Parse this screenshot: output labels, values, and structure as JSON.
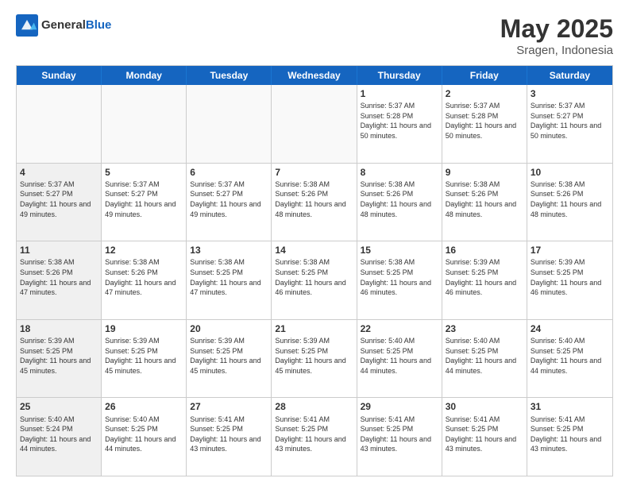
{
  "header": {
    "logo_general": "General",
    "logo_blue": "Blue",
    "month_year": "May 2025",
    "location": "Sragen, Indonesia"
  },
  "day_headers": [
    "Sunday",
    "Monday",
    "Tuesday",
    "Wednesday",
    "Thursday",
    "Friday",
    "Saturday"
  ],
  "weeks": [
    [
      {
        "num": "",
        "info": "",
        "shaded": true
      },
      {
        "num": "",
        "info": "",
        "shaded": true
      },
      {
        "num": "",
        "info": "",
        "shaded": true
      },
      {
        "num": "",
        "info": "",
        "shaded": true
      },
      {
        "num": "1",
        "info": "Sunrise: 5:37 AM\nSunset: 5:28 PM\nDaylight: 11 hours\nand 50 minutes.",
        "shaded": false
      },
      {
        "num": "2",
        "info": "Sunrise: 5:37 AM\nSunset: 5:28 PM\nDaylight: 11 hours\nand 50 minutes.",
        "shaded": false
      },
      {
        "num": "3",
        "info": "Sunrise: 5:37 AM\nSunset: 5:27 PM\nDaylight: 11 hours\nand 50 minutes.",
        "shaded": false
      }
    ],
    [
      {
        "num": "4",
        "info": "Sunrise: 5:37 AM\nSunset: 5:27 PM\nDaylight: 11 hours\nand 49 minutes.",
        "shaded": true
      },
      {
        "num": "5",
        "info": "Sunrise: 5:37 AM\nSunset: 5:27 PM\nDaylight: 11 hours\nand 49 minutes.",
        "shaded": false
      },
      {
        "num": "6",
        "info": "Sunrise: 5:37 AM\nSunset: 5:27 PM\nDaylight: 11 hours\nand 49 minutes.",
        "shaded": false
      },
      {
        "num": "7",
        "info": "Sunrise: 5:38 AM\nSunset: 5:26 PM\nDaylight: 11 hours\nand 48 minutes.",
        "shaded": false
      },
      {
        "num": "8",
        "info": "Sunrise: 5:38 AM\nSunset: 5:26 PM\nDaylight: 11 hours\nand 48 minutes.",
        "shaded": false
      },
      {
        "num": "9",
        "info": "Sunrise: 5:38 AM\nSunset: 5:26 PM\nDaylight: 11 hours\nand 48 minutes.",
        "shaded": false
      },
      {
        "num": "10",
        "info": "Sunrise: 5:38 AM\nSunset: 5:26 PM\nDaylight: 11 hours\nand 48 minutes.",
        "shaded": false
      }
    ],
    [
      {
        "num": "11",
        "info": "Sunrise: 5:38 AM\nSunset: 5:26 PM\nDaylight: 11 hours\nand 47 minutes.",
        "shaded": true
      },
      {
        "num": "12",
        "info": "Sunrise: 5:38 AM\nSunset: 5:26 PM\nDaylight: 11 hours\nand 47 minutes.",
        "shaded": false
      },
      {
        "num": "13",
        "info": "Sunrise: 5:38 AM\nSunset: 5:25 PM\nDaylight: 11 hours\nand 47 minutes.",
        "shaded": false
      },
      {
        "num": "14",
        "info": "Sunrise: 5:38 AM\nSunset: 5:25 PM\nDaylight: 11 hours\nand 46 minutes.",
        "shaded": false
      },
      {
        "num": "15",
        "info": "Sunrise: 5:38 AM\nSunset: 5:25 PM\nDaylight: 11 hours\nand 46 minutes.",
        "shaded": false
      },
      {
        "num": "16",
        "info": "Sunrise: 5:39 AM\nSunset: 5:25 PM\nDaylight: 11 hours\nand 46 minutes.",
        "shaded": false
      },
      {
        "num": "17",
        "info": "Sunrise: 5:39 AM\nSunset: 5:25 PM\nDaylight: 11 hours\nand 46 minutes.",
        "shaded": false
      }
    ],
    [
      {
        "num": "18",
        "info": "Sunrise: 5:39 AM\nSunset: 5:25 PM\nDaylight: 11 hours\nand 45 minutes.",
        "shaded": true
      },
      {
        "num": "19",
        "info": "Sunrise: 5:39 AM\nSunset: 5:25 PM\nDaylight: 11 hours\nand 45 minutes.",
        "shaded": false
      },
      {
        "num": "20",
        "info": "Sunrise: 5:39 AM\nSunset: 5:25 PM\nDaylight: 11 hours\nand 45 minutes.",
        "shaded": false
      },
      {
        "num": "21",
        "info": "Sunrise: 5:39 AM\nSunset: 5:25 PM\nDaylight: 11 hours\nand 45 minutes.",
        "shaded": false
      },
      {
        "num": "22",
        "info": "Sunrise: 5:40 AM\nSunset: 5:25 PM\nDaylight: 11 hours\nand 44 minutes.",
        "shaded": false
      },
      {
        "num": "23",
        "info": "Sunrise: 5:40 AM\nSunset: 5:25 PM\nDaylight: 11 hours\nand 44 minutes.",
        "shaded": false
      },
      {
        "num": "24",
        "info": "Sunrise: 5:40 AM\nSunset: 5:25 PM\nDaylight: 11 hours\nand 44 minutes.",
        "shaded": false
      }
    ],
    [
      {
        "num": "25",
        "info": "Sunrise: 5:40 AM\nSunset: 5:24 PM\nDaylight: 11 hours\nand 44 minutes.",
        "shaded": true
      },
      {
        "num": "26",
        "info": "Sunrise: 5:40 AM\nSunset: 5:25 PM\nDaylight: 11 hours\nand 44 minutes.",
        "shaded": false
      },
      {
        "num": "27",
        "info": "Sunrise: 5:41 AM\nSunset: 5:25 PM\nDaylight: 11 hours\nand 43 minutes.",
        "shaded": false
      },
      {
        "num": "28",
        "info": "Sunrise: 5:41 AM\nSunset: 5:25 PM\nDaylight: 11 hours\nand 43 minutes.",
        "shaded": false
      },
      {
        "num": "29",
        "info": "Sunrise: 5:41 AM\nSunset: 5:25 PM\nDaylight: 11 hours\nand 43 minutes.",
        "shaded": false
      },
      {
        "num": "30",
        "info": "Sunrise: 5:41 AM\nSunset: 5:25 PM\nDaylight: 11 hours\nand 43 minutes.",
        "shaded": false
      },
      {
        "num": "31",
        "info": "Sunrise: 5:41 AM\nSunset: 5:25 PM\nDaylight: 11 hours\nand 43 minutes.",
        "shaded": false
      }
    ]
  ]
}
